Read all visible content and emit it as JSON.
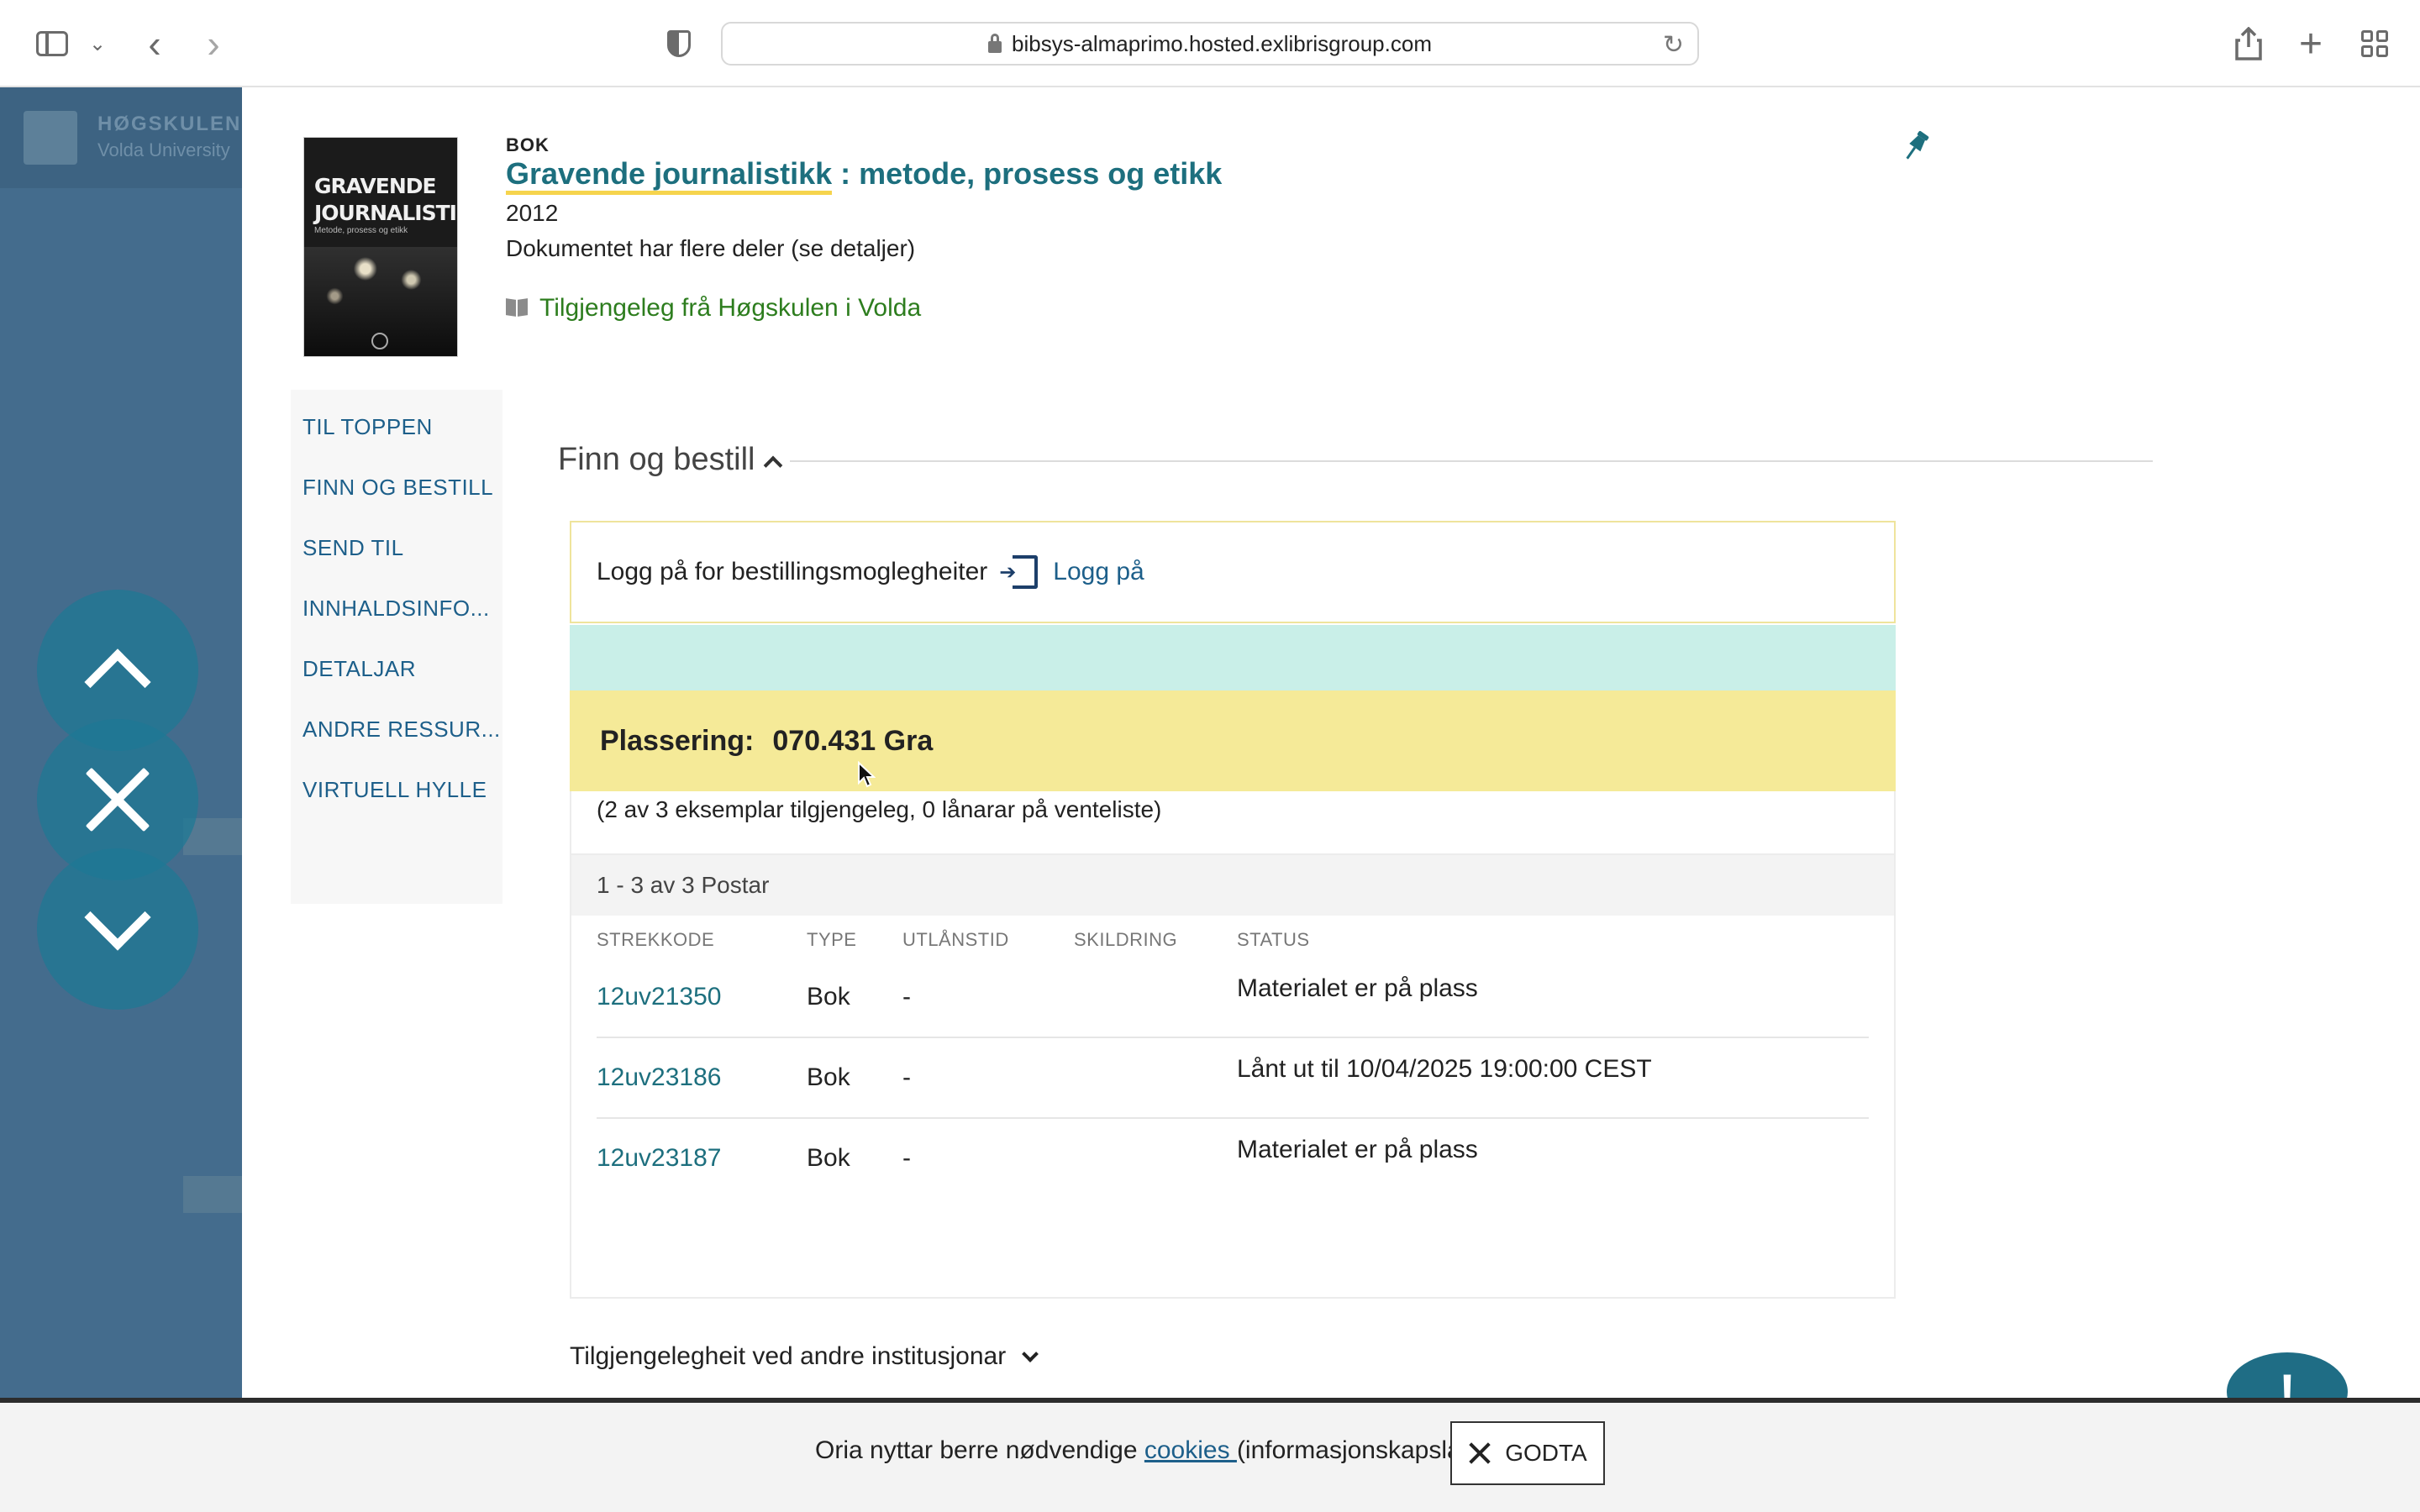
{
  "browser": {
    "url": "bibsys-almaprimo.hosted.exlibrisgroup.com"
  },
  "background_page": {
    "title_line1": "HØGSKULEN",
    "title_line2": "Volda University"
  },
  "record": {
    "type": "BOK",
    "title_highlight": "Gravende journalistikk",
    "title_rest": " : metode, prosess og etikk",
    "year": "2012",
    "parts_note": "Dokumentet har flere deler (se detaljer)",
    "availability": "Tilgjengeleg frå Høgskulen i Volda",
    "cover": {
      "title_line1": "GRAVENDE",
      "title_line2": "JOURNALISTIKK",
      "subtitle": "Metode, prosess og etikk"
    }
  },
  "section_nav": [
    {
      "label": "TIL TOPPEN"
    },
    {
      "label": "FINN OG BESTILL"
    },
    {
      "label": "SEND TIL"
    },
    {
      "label": "INNHALDSINFO..."
    },
    {
      "label": "DETALJAR"
    },
    {
      "label": "ANDRE RESSUR..."
    },
    {
      "label": "VIRTUELL HYLLE"
    }
  ],
  "finn": {
    "heading": "Finn og bestill",
    "login_prompt": "Logg på for bestillingsmoglegheiter",
    "login_link": "Logg på",
    "location_label": "Plassering:",
    "location_value": "070.431 Gra",
    "copies_summary": "(2 av 3 eksemplar tilgjengeleg, 0 lånarar på venteliste)",
    "records_count": "1 - 3 av 3 Postar",
    "columns": {
      "barcode": "STREKKODE",
      "type": "TYPE",
      "loan_time": "UTLÅNSTID",
      "shelving": "SKILDRING",
      "status": "STATUS"
    },
    "items": [
      {
        "barcode": "12uv21350",
        "type": "Bok",
        "loan_time": "-",
        "status": "Materialet er på plass"
      },
      {
        "barcode": "12uv23186",
        "type": "Bok",
        "loan_time": "-",
        "status": "Lånt ut til 10/04/2025 19:00:00 CEST"
      },
      {
        "barcode": "12uv23187",
        "type": "Bok",
        "loan_time": "-",
        "status": "Materialet er på plass"
      }
    ],
    "other_institutions": "Tilgjengelegheit ved andre institusjonar"
  },
  "feedback": {
    "symbol": "!"
  },
  "cookie": {
    "text_before": "Oria nyttar berre nødvendige ",
    "link": "cookies ",
    "text_after": "(informasjonskapslar).",
    "accept_label": "GODTA"
  },
  "colors": {
    "accent": "#1d6f7e",
    "link": "#1d5f8a",
    "available": "#2d7d1e",
    "location_bg": "#f5ea98",
    "teal_strip": "#c9efe8",
    "nav_circle": "#1d7894"
  }
}
